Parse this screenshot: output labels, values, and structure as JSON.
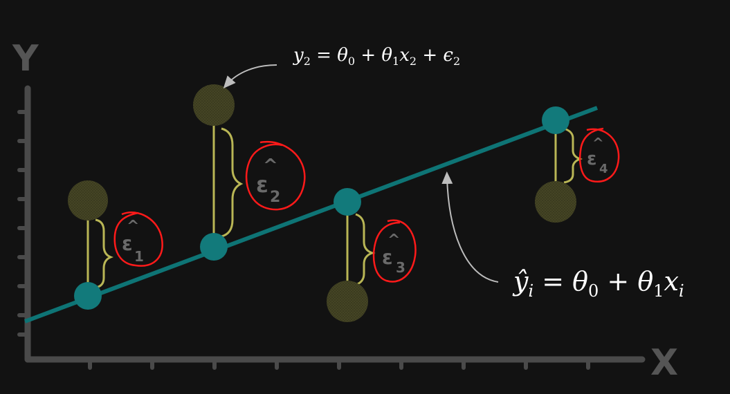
{
  "axes": {
    "y_label": "Y",
    "x_label": "X"
  },
  "equations": {
    "observed": {
      "y": "y",
      "y_sub": "2",
      "eq": " = ",
      "t0": "θ",
      "t0_sub": "0",
      "plus1": " + ",
      "t1": "θ",
      "t1_sub": "1",
      "x": "x",
      "x_sub": "2",
      "plus2": " + ",
      "e": "ϵ",
      "e_sub": "2"
    },
    "fitted": {
      "y": "ŷ",
      "y_sub": "i",
      "eq": " = ",
      "t0": "θ",
      "t0_sub": "0",
      "plus": " + ",
      "t1": "θ",
      "t1_sub": "1",
      "x": "x",
      "x_sub": "i"
    }
  },
  "residuals": [
    {
      "hat": "^",
      "symbol": "ε",
      "subscript": "1"
    },
    {
      "hat": "^",
      "symbol": "ε",
      "subscript": "2"
    },
    {
      "hat": "^",
      "symbol": "ε",
      "subscript": "3"
    },
    {
      "hat": "^",
      "symbol": "ε",
      "subscript": "4"
    }
  ],
  "colors": {
    "background": "#121212",
    "regression_line": "#0e7475",
    "fitted_point": "#127a7b",
    "observed_point": "#3a3a1e",
    "residual_line": "#b9b655",
    "brace": "#b9b655",
    "annotation_circle": "#ff1a1a",
    "axis": "#4a4a4a",
    "arrow": "#bdbdbd"
  },
  "icons": {
    "annotation_arrow": "curved-arrow-icon"
  }
}
